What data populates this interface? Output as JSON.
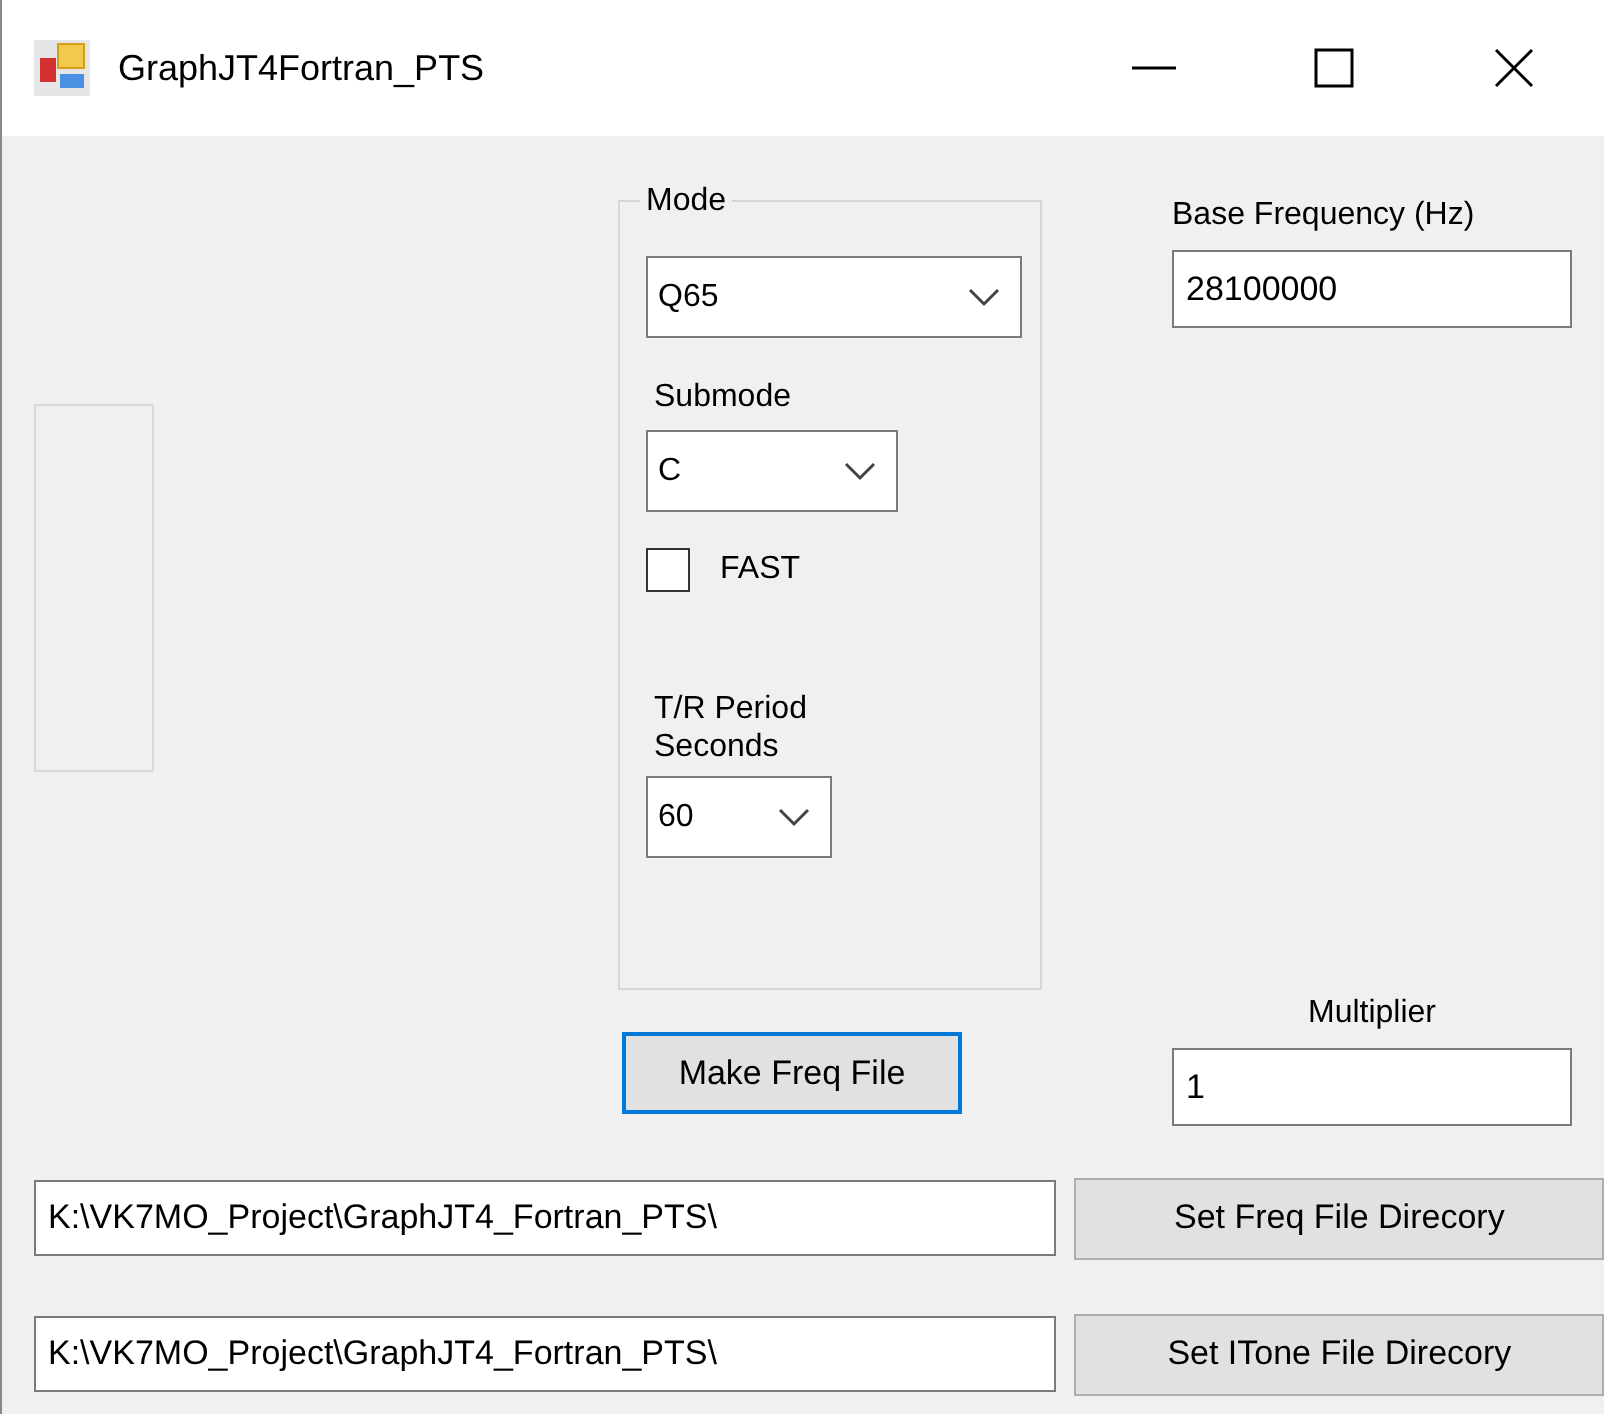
{
  "window": {
    "title": "GraphJT4Fortran_PTS"
  },
  "mode_group": {
    "title": "Mode",
    "mode": {
      "value": "Q65"
    },
    "submode_label": "Submode",
    "submode": {
      "value": "C"
    },
    "fast": {
      "label": "FAST",
      "checked": false
    },
    "tr_period_label": "T/R Period\nSeconds",
    "tr_period": {
      "value": "60"
    }
  },
  "base_frequency": {
    "label": "Base Frequency (Hz)",
    "value": "28100000"
  },
  "make_button": {
    "label": "Make Freq File",
    "focused": true
  },
  "multiplier": {
    "label": "Multiplier",
    "value": "1"
  },
  "directories": [
    {
      "path": "K:\\VK7MO_Project\\GraphJT4_Fortran_PTS\\",
      "button": "Set Freq File Direcory"
    },
    {
      "path": "K:\\VK7MO_Project\\GraphJT4_Fortran_PTS\\",
      "button": "Set ITone File Direcory"
    }
  ]
}
